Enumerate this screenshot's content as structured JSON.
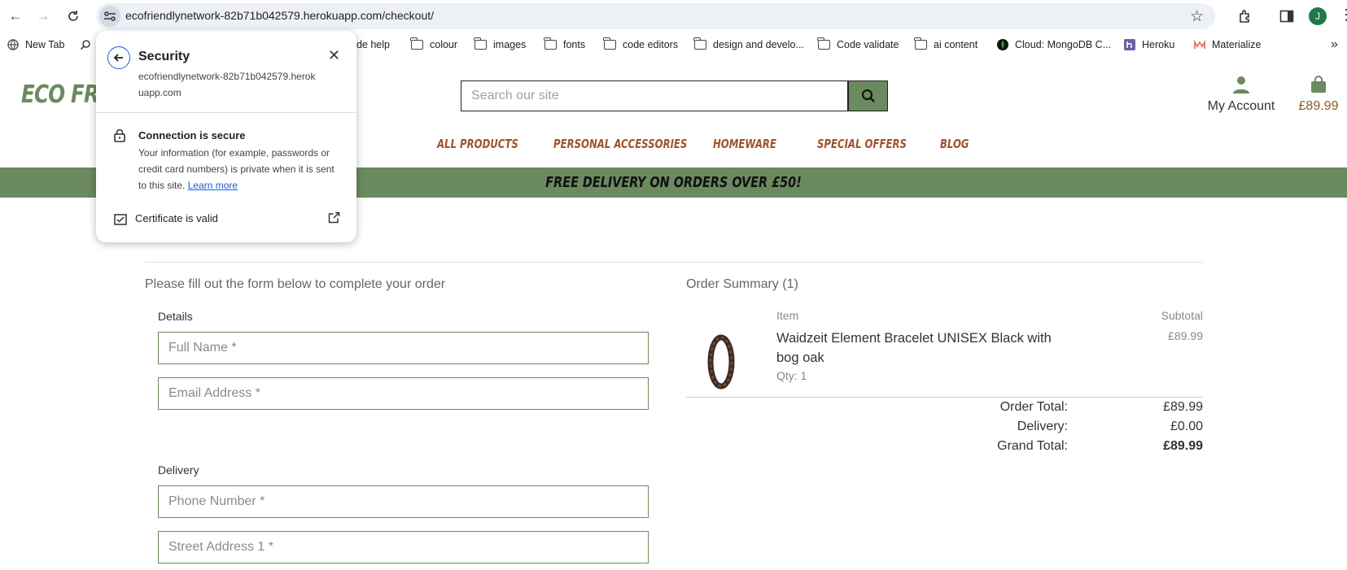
{
  "browser": {
    "url": "ecofriendlynetwork-82b71b042579.herokuapp.com/checkout/",
    "profile_initial": "J",
    "bookmarks": [
      {
        "label": "New Tab",
        "icon": "globe-icon"
      },
      {
        "label": "",
        "icon": "search-icon"
      },
      {
        "label": "ode help",
        "icon": "folder-icon"
      },
      {
        "label": "colour",
        "icon": "folder-icon"
      },
      {
        "label": "images",
        "icon": "folder-icon"
      },
      {
        "label": "fonts",
        "icon": "folder-icon"
      },
      {
        "label": "code editors",
        "icon": "folder-icon"
      },
      {
        "label": "design and develo...",
        "icon": "folder-icon"
      },
      {
        "label": "Code validate",
        "icon": "folder-icon"
      },
      {
        "label": "ai content",
        "icon": "folder-icon"
      },
      {
        "label": "Cloud: MongoDB C...",
        "icon": "mongodb-leaf-icon"
      },
      {
        "label": "Heroku",
        "icon": "heroku-icon"
      },
      {
        "label": "Materialize",
        "icon": "materialize-icon"
      }
    ]
  },
  "security_popup": {
    "title": "Security",
    "host": "ecofriendlynetwork-82b71b042579.herokuapp.com",
    "connection_title": "Connection is secure",
    "connection_body": "Your information (for example, passwords or credit card numbers) is private when it is sent to this site.",
    "learn_more": "Learn more",
    "certificate": "Certificate is valid"
  },
  "site": {
    "logo": "ECO FRIE",
    "search_placeholder": "Search our site",
    "account_label": "My Account",
    "cart_total": "£89.99",
    "nav": [
      "ALL PRODUCTS",
      "PERSONAL ACCESSORIES",
      "HOMEWARE",
      "SPECIAL OFFERS",
      "BLOG"
    ],
    "banner": "FREE DELIVERY ON ORDERS OVER £50!",
    "accent_color": "#6b8a5f",
    "nav_color": "#a0522d"
  },
  "checkout": {
    "intro": "Please fill out the form below to complete your order",
    "details_label": "Details",
    "full_name_placeholder": "Full Name *",
    "email_placeholder": "Email Address *",
    "delivery_label": "Delivery",
    "phone_placeholder": "Phone Number *",
    "street1_placeholder": "Street Address 1 *"
  },
  "summary": {
    "title": "Order Summary (1)",
    "col_item": "Item",
    "col_subtotal": "Subtotal",
    "item_name": "Waidzeit Element Bracelet UNISEX Black with bog oak",
    "item_qty": "Qty: 1",
    "item_subtotal": "£89.99",
    "order_total_label": "Order Total:",
    "order_total": "£89.99",
    "delivery_label": "Delivery:",
    "delivery": "£0.00",
    "grand_total_label": "Grand Total:",
    "grand_total": "£89.99"
  }
}
